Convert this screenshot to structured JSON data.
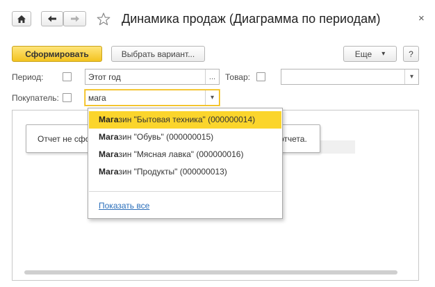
{
  "window": {
    "title": "Динамика продаж (Диаграмма по периодам)",
    "close_glyph": "×",
    "icons": [
      "home-icon",
      "back-arrow-icon",
      "forward-arrow-icon",
      "favorite-star-icon",
      "close-icon"
    ]
  },
  "toolbar": {
    "generate_label": "Сформировать",
    "choose_variant_label": "Выбрать вариант...",
    "more_label": "Еще",
    "more_arrow": "▾",
    "help_label": "?"
  },
  "filters": {
    "period_label": "Период:",
    "period_checked": false,
    "period_value": "Этот год",
    "period_button": "...",
    "product_label": "Товар:",
    "product_checked": false,
    "product_value": "",
    "product_arrow": "▾",
    "buyer_label": "Покупатель:",
    "buyer_checked": false,
    "buyer_value": "мага",
    "buyer_arrow": "▾"
  },
  "report": {
    "notice_left": "Отчет не сфо",
    "notice_right": "отчета."
  },
  "dropdown": {
    "items": [
      {
        "match": "Мага",
        "rest": "зин \"Бытовая техника\" (000000014)",
        "selected": true
      },
      {
        "match": "Мага",
        "rest": "зин \"Обувь\" (000000015)",
        "selected": false
      },
      {
        "match": "Мага",
        "rest": "зин \"Мясная лавка\" (000000016)",
        "selected": false
      },
      {
        "match": "Мага",
        "rest": "зин \"Продукты\" (000000013)",
        "selected": false
      }
    ],
    "show_all_label": "Показать все"
  },
  "colors": {
    "accent_yellow": "#f3c320",
    "selection_yellow": "#fbd52c",
    "focus_border": "#f0b400",
    "link_blue": "#2a6eba"
  }
}
